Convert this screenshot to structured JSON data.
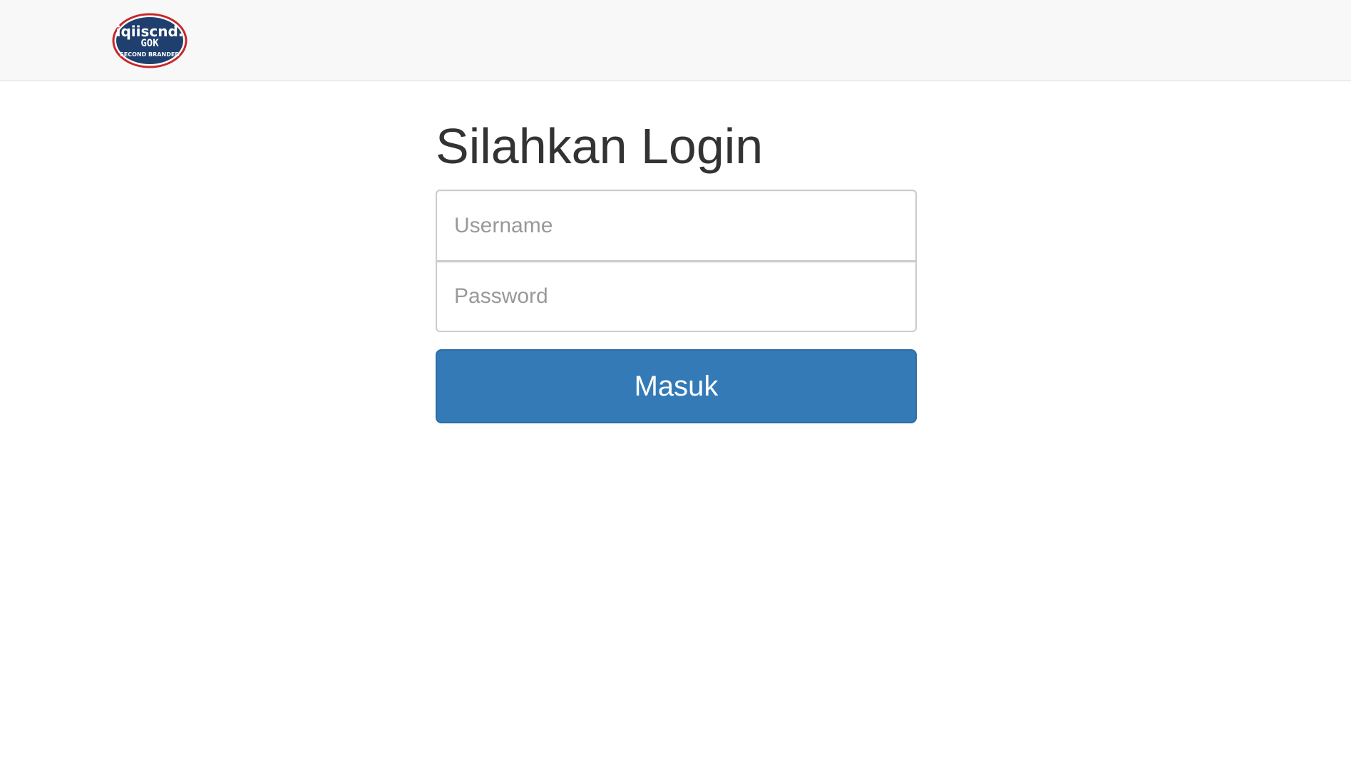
{
  "header": {
    "logo": {
      "icon": "brand-logo",
      "text_top": "iqiiscnd.",
      "text_middle": "GOK",
      "text_bottom": "SECOND BRANDED",
      "colors": {
        "fill": "#1f3f6e",
        "ring": "#c62828",
        "text": "#ffffff"
      }
    }
  },
  "login": {
    "title": "Silahkan Login",
    "username_placeholder": "Username",
    "password_placeholder": "Password",
    "submit_label": "Masuk",
    "accent_color": "#337ab7"
  }
}
